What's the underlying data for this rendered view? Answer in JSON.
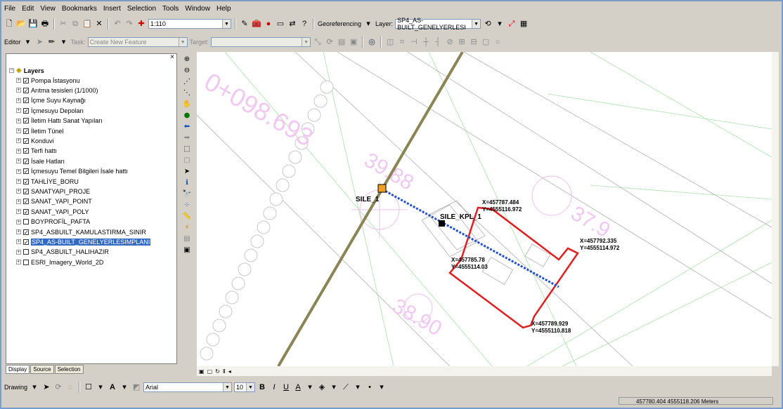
{
  "menu": [
    "File",
    "Edit",
    "View",
    "Bookmarks",
    "Insert",
    "Selection",
    "Tools",
    "Window",
    "Help"
  ],
  "toolbar1": {
    "scale": "1:110",
    "georef_label": "Georeferencing",
    "layer_label": "Layer:",
    "layer_value": "SP4_AS-BUILT_GENELYERLESI"
  },
  "toolbar2": {
    "editor_label": "Editor",
    "task_label": "Task:",
    "task_value": "Create New Feature",
    "target_label": "Target:",
    "target_value": ""
  },
  "toc": {
    "title": "Layers",
    "layers": [
      {
        "name": "Pompa İstasyonu",
        "checked": true
      },
      {
        "name": "Arıtma tesisleri (1/1000)",
        "checked": true
      },
      {
        "name": "İçme Suyu Kaynağı",
        "checked": true
      },
      {
        "name": "İçmesuyu Depoları",
        "checked": true
      },
      {
        "name": "İletim Hattı Sanat Yapıları",
        "checked": true
      },
      {
        "name": "İletim Tünel",
        "checked": true
      },
      {
        "name": "Konduvi",
        "checked": true
      },
      {
        "name": "Terfi hattı",
        "checked": true
      },
      {
        "name": "İsale Hatları",
        "checked": true
      },
      {
        "name": "İçmesuyu Temel Bilgileri İsale hattı",
        "checked": true
      },
      {
        "name": "TAHLİYE_BORU",
        "checked": true
      },
      {
        "name": "SANATYAPI_PROJE",
        "checked": true
      },
      {
        "name": "SANAT_YAPI_POINT",
        "checked": true
      },
      {
        "name": "SANAT_YAPI_POLY",
        "checked": true
      },
      {
        "name": "BOYPROFİL_PAFTA",
        "checked": false
      },
      {
        "name": "SP4_ASBUILT_KAMULASTIRMA_SINIR",
        "checked": true
      },
      {
        "name": "SP4_AS-BUILT_GENELYERLESIMPLANI",
        "checked": true,
        "selected": true
      },
      {
        "name": "SP4_ASBUILT_HALIHAZIR",
        "checked": false
      },
      {
        "name": "ESRI_Imagery_World_2D",
        "checked": false
      }
    ],
    "tabs": [
      "Display",
      "Source",
      "Selection"
    ]
  },
  "map": {
    "station_label": "0+098.693",
    "dim1": "39.88",
    "dim2": "38.90",
    "dim3": "37.9",
    "sile1": "SILE_1",
    "sile_kpl": "SILE_KPL_1",
    "pt1": [
      "X=457787.484",
      "Y=4555116.972"
    ],
    "pt2": [
      "X=457792.335",
      "Y=4555114.972"
    ],
    "pt3": [
      "X=457785.78",
      "Y=4555114.03"
    ],
    "pt4": [
      "X=457789.929",
      "Y=4555110.818"
    ],
    "colors": {
      "red": "#e02020",
      "blue": "#1f4fd0",
      "pipe": "#8b8455",
      "magenta": "#e8a0e8",
      "green": "#9fdf9f"
    }
  },
  "drawing": {
    "label": "Drawing",
    "font": "Arial",
    "size": "10",
    "bold": "B",
    "italic": "I",
    "underline": "U"
  },
  "status": {
    "coords": "457780.404  4555118.206 Meters"
  }
}
